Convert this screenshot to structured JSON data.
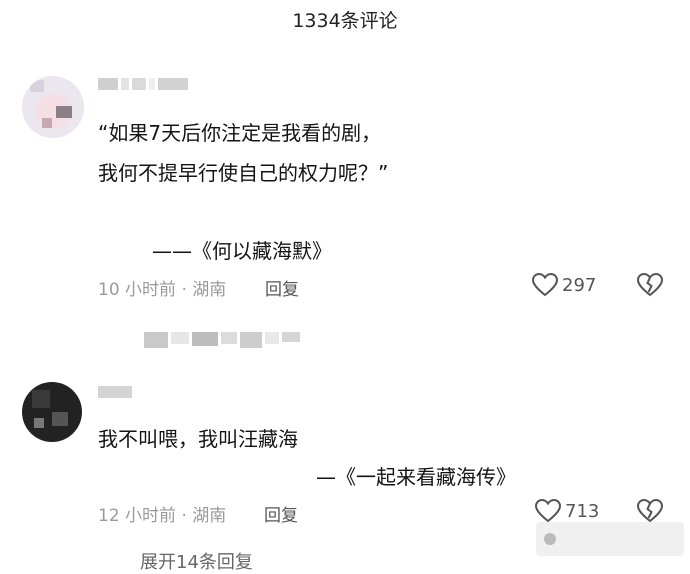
{
  "header": {
    "title": "1334条评论"
  },
  "comments": [
    {
      "line1": "“如果7天后你注定是我看的剧，",
      "line2": "我何不提早行使自己的权力呢？”",
      "attribution": "——《何以藏海默》",
      "time": "10 小时前 · 湖南",
      "reply_label": "回复",
      "likes": "297"
    },
    {
      "line1": "我不叫喂，我叫汪藏海",
      "attribution": "—《一起来看藏海传》",
      "time": "12 小时前 · 湖南",
      "reply_label": "回复",
      "likes": "713"
    }
  ],
  "more_replies": "展开14条回复",
  "colors": {
    "meta": "#9a9a9a",
    "text": "#141414"
  },
  "icons": [
    "heart-icon",
    "broken-heart-icon"
  ]
}
